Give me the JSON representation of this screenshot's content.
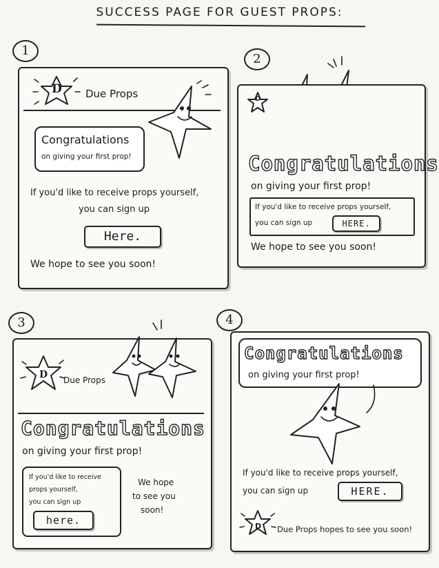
{
  "title": "SUCCESS PAGE FOR GUEST PROPS:",
  "panels": [
    {
      "number": "1",
      "logo_letter": "D",
      "brand": "Due Props",
      "congrats": "Congratulations",
      "subtitle": "on giving your first prop!",
      "signup_line1": "If you'd like to receive props yourself,",
      "signup_line2": "you can sign up",
      "button": "Here.",
      "closing": "We hope to see you soon!"
    },
    {
      "number": "2",
      "logo_letter": "D",
      "congrats": "Congratulations",
      "subtitle": "on giving your first prop!",
      "signup_line1": "If you'd like to receive props yourself,",
      "signup_line2": "you can sign up",
      "button": "HERE.",
      "closing": "We hope to see you soon!"
    },
    {
      "number": "3",
      "logo_letter": "D",
      "brand": "Due Props",
      "congrats": "Congratulations",
      "subtitle": "on giving your first prop!",
      "signup_line1": "If you'd like to receive",
      "signup_line2": "props yourself,",
      "signup_line3": "you can sign up",
      "button": "here.",
      "closing_line1": "We hope",
      "closing_line2": "to see you",
      "closing_line3": "soon!"
    },
    {
      "number": "4",
      "logo_letter": "D",
      "congrats": "Congratulations",
      "subtitle": "on giving your first prop!",
      "signup_line1": "If you'd like to receive props yourself,",
      "signup_line2": "you can sign up",
      "button": "HERE.",
      "closing": "Due Props hopes to see you soon!"
    }
  ]
}
